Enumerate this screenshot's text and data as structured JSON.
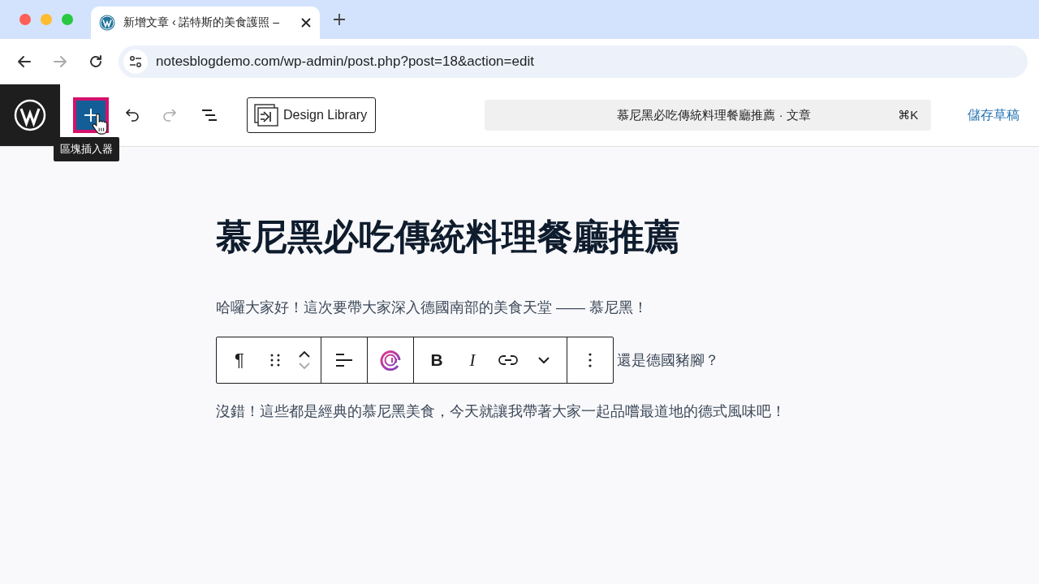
{
  "browser": {
    "tab": {
      "title": "新增文章 ‹ 諾特斯的美食護照 –",
      "selected": true
    },
    "nav_buttons": [
      {
        "kind": "back",
        "disabled": false
      },
      {
        "kind": "forward",
        "disabled": true
      },
      {
        "kind": "reload",
        "disabled": false
      }
    ],
    "url": "notesblogdemo.com/wp-admin/post.php?post=18&action=edit"
  },
  "editor_header": {
    "tools": [
      {
        "kind": "inserter",
        "disabled": false,
        "highlighted": true
      },
      {
        "kind": "undo",
        "disabled": false,
        "highlighted": false
      },
      {
        "kind": "redo",
        "disabled": true,
        "highlighted": false
      },
      {
        "kind": "list",
        "disabled": false,
        "highlighted": false
      }
    ],
    "design_library": "Design Library",
    "command_bar": {
      "title": "慕尼黑必吃傳統料理餐廳推薦 · 文章",
      "shortcut": "⌘K"
    },
    "save_draft": "儲存草稿",
    "tooltip": "區塊插入器"
  },
  "post": {
    "title": "慕尼黑必吃傳統料理餐廳推薦",
    "paragraphs": [
      "哈囉大家好！這次要帶大家深入德國南部的美食天堂 —— 慕尼黑！",
      "還是德國豬腳？",
      "沒錯！這些都是經典的慕尼黑美食，今天就讓我帶著大家一起品嚐最道地的德式風味吧！"
    ]
  },
  "block_toolbar": {
    "paragraph_symbol": "¶",
    "move_up_disabled": false,
    "move_down_disabled": true,
    "bold": "B",
    "italic": "I"
  }
}
